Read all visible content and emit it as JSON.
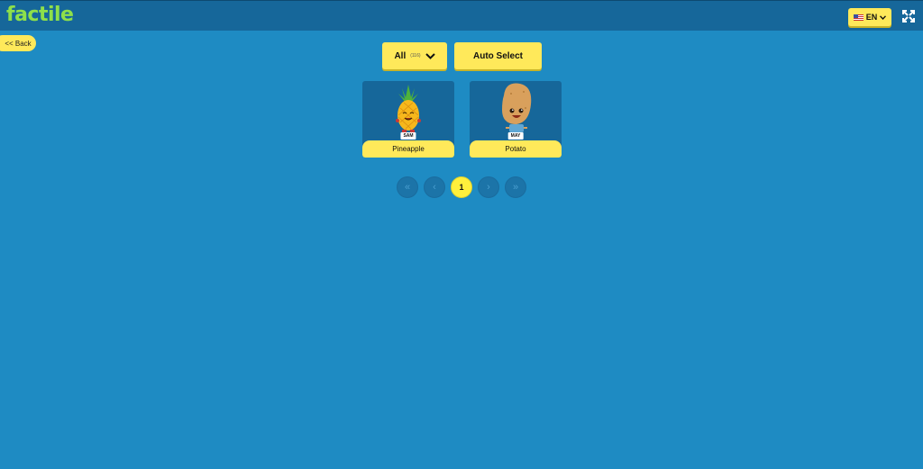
{
  "app": {
    "logo_text": "factile",
    "language": "EN",
    "brand_color": "#8ee04a",
    "accent_color": "#ffe95a",
    "background_color": "#1e8bc3"
  },
  "nav": {
    "back_label": "<< Back"
  },
  "toolbar": {
    "filter_label": "All",
    "filter_count": "(116)",
    "auto_select_label": "Auto Select"
  },
  "cards": [
    {
      "title": "Pineapple",
      "tag": "SAM",
      "icon": "pineapple-character"
    },
    {
      "title": "Potato",
      "tag": "MAY",
      "icon": "potato-character"
    }
  ],
  "pagination": {
    "first": "«",
    "prev": "‹",
    "current": "1",
    "next": "›",
    "last": "»"
  }
}
